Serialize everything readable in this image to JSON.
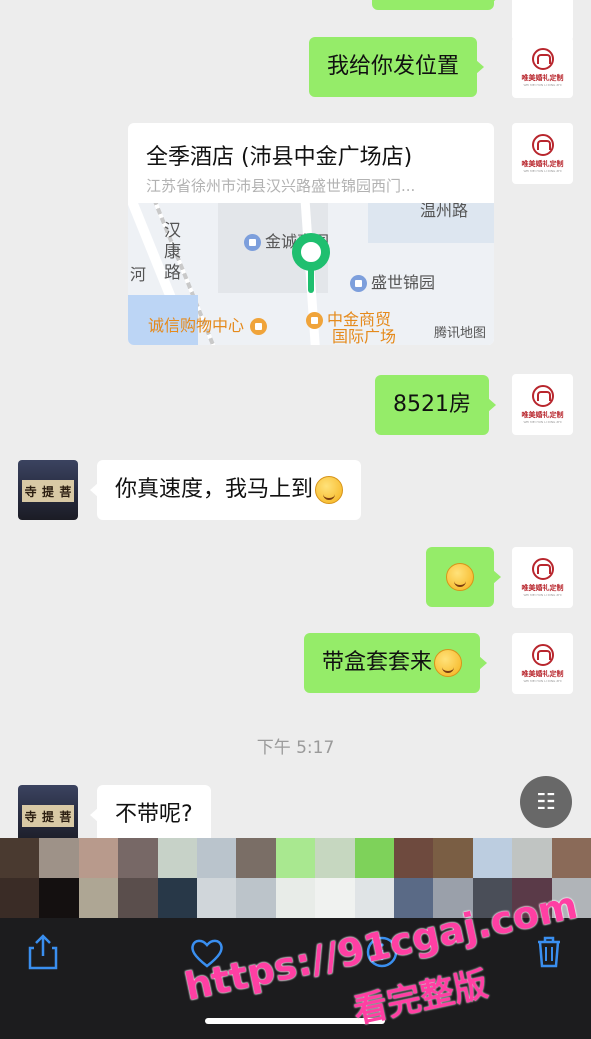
{
  "messages": {
    "m1": {
      "text": "我给你发位置"
    },
    "location": {
      "name": "全季酒店 (沛县中金广场店)",
      "address": "江苏省徐州市沛县汉兴路盛世锦园西门...",
      "map_labels": {
        "road_hankang": "汉康路",
        "river": "河",
        "jincheng": "金诚嘉园",
        "wenzhou": "温州路",
        "shengshi": "盛世锦园",
        "chengxin": "诚信购物中心",
        "zhongjin": "中金商贸",
        "guoji": "国际广场",
        "credit": "腾讯地图"
      }
    },
    "m2": {
      "text": "8521房"
    },
    "m3": {
      "text": "你真速度，我马上到"
    },
    "m4": {
      "text": ""
    },
    "m5": {
      "text": "带盒套套来"
    },
    "time": "下午 5:17",
    "m6": {
      "text": "不带呢?"
    }
  },
  "avatar_me": {
    "brand": "唯美婚礼定制",
    "sub": "WEI MEI HUN LI DING ZHI"
  },
  "avatar_other": {
    "chars": [
      "寺",
      "提",
      "菩"
    ]
  },
  "icons": {
    "scan": "scan-text-icon",
    "share": "share-icon",
    "like": "heart-icon",
    "info": "info-icon",
    "delete": "trash-icon"
  },
  "watermark": {
    "url": "https://91cgaj.com",
    "sub": "看完整版"
  },
  "colors": {
    "bubble_green": "#95ec69",
    "background": "#ededed",
    "toolbar": "#1c1c1e",
    "ios_blue": "#3a8ff0"
  }
}
